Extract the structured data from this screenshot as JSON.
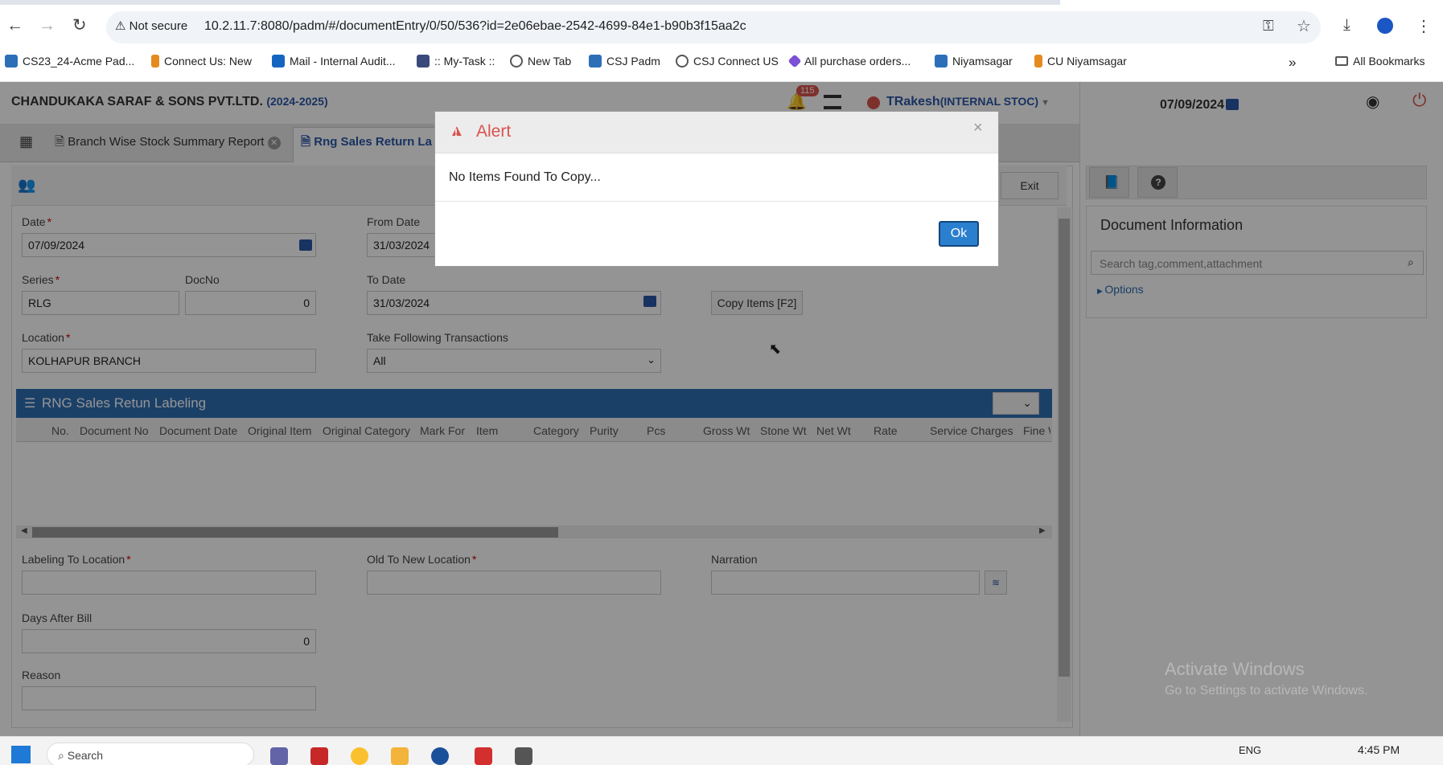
{
  "browser": {
    "security_label": "Not secure",
    "url": "10.2.11.7:8080/padm/#/documentEntry/0/50/536?id=2e06ebae-2542-4699-84e1-b90b3f15aa2c",
    "bookmarks": [
      {
        "label": "CS23_24-Acme Pad...",
        "color": "#2c6fb8"
      },
      {
        "label": "Connect Us: New",
        "color": "#e58a1f"
      },
      {
        "label": "Mail - Internal Audit...",
        "color": "#1565c0"
      },
      {
        "label": ":: My-Task ::",
        "color": "#3a4a7a"
      },
      {
        "label": "New Tab",
        "color": "#555555"
      },
      {
        "label": "CSJ Padm",
        "color": "#2c6fb8"
      },
      {
        "label": "CSJ Connect US",
        "color": "#555555"
      },
      {
        "label": "All purchase orders...",
        "color": "#7b4fd6"
      },
      {
        "label": "Niyamsagar",
        "color": "#2c6fb8"
      },
      {
        "label": "CU Niyamsagar",
        "color": "#e58a1f"
      }
    ],
    "more_label": "»",
    "all_bookmarks": "All Bookmarks"
  },
  "app": {
    "company": "CHANDUKAKA SARAF & SONS PVT.LTD.",
    "year": "(2024-2025)",
    "notification_count": "115",
    "user": "TRakesh",
    "user_suffix": "(INTERNAL STOC)",
    "date": "07/09/2024"
  },
  "tabs": [
    {
      "label": "Branch Wise Stock Summary Report"
    },
    {
      "label": "Rng Sales Return La"
    }
  ],
  "toolbar": {
    "exit_label": "Exit"
  },
  "form": {
    "date_label": "Date",
    "date_value": "07/09/2024",
    "from_date_label": "From Date",
    "from_date_value": "31/03/2024",
    "series_label": "Series",
    "series_value": "RLG",
    "docno_label": "DocNo",
    "docno_value": "0",
    "to_date_label": "To Date",
    "to_date_value": "31/03/2024",
    "copy_button": "Copy Items [F2]",
    "location_label": "Location",
    "location_value": "KOLHAPUR BRANCH",
    "take_label": "Take Following Transactions",
    "take_value": "All",
    "grid_title": "RNG Sales Retun Labeling",
    "columns": [
      "No.",
      "Document No",
      "Document Date",
      "Original Item",
      "Original Category",
      "Mark For",
      "Item",
      "Category",
      "Purity",
      "Pcs",
      "Gross Wt",
      "Stone Wt",
      "Net Wt",
      "Rate",
      "Service Charges",
      "Fine W"
    ],
    "labeling_to_label": "Labeling To Location",
    "old_to_new_label": "Old To New Location",
    "narration_label": "Narration",
    "days_after_label": "Days After Bill",
    "days_after_value": "0",
    "reason_label": "Reason"
  },
  "right_panel": {
    "title": "Document Information",
    "search_placeholder": "Search tag,comment,attachment",
    "options_label": "Options",
    "activate_title": "Activate Windows",
    "activate_sub": "Go to Settings to activate Windows."
  },
  "dialog": {
    "title": "Alert",
    "message": "No Items Found To Copy...",
    "ok_label": "Ok",
    "close_label": "×"
  },
  "taskbar": {
    "search_label": "Search",
    "lang": "ENG",
    "time": "4:45 PM"
  }
}
